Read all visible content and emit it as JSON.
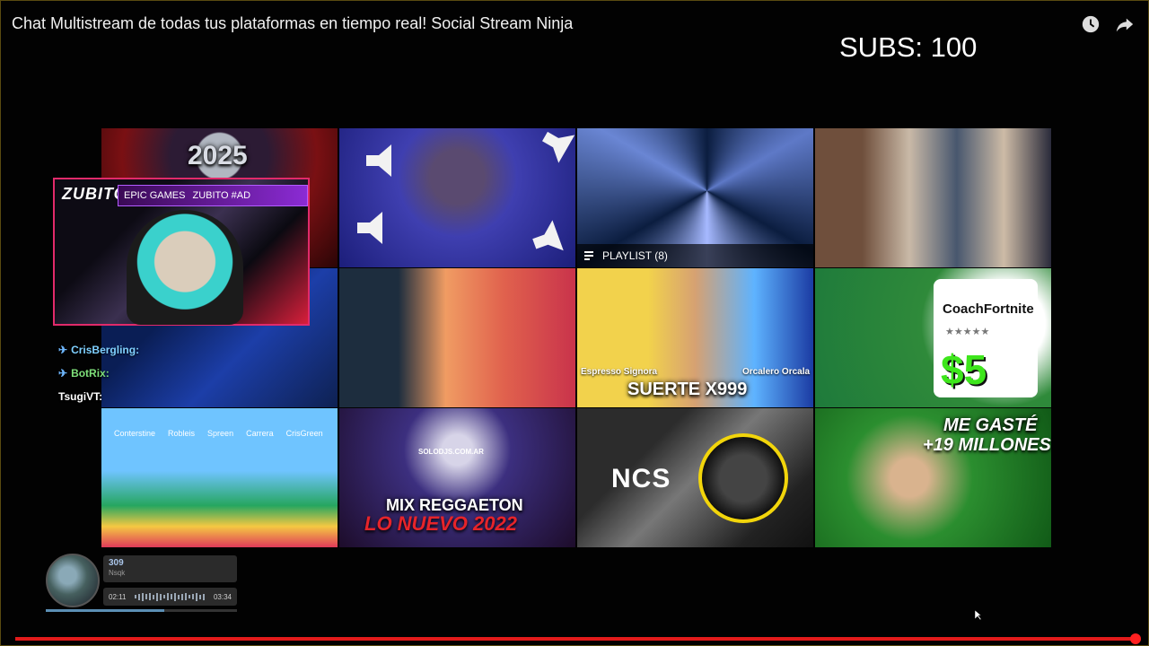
{
  "video": {
    "title": "Chat Multistream de todas tus plataformas en tiempo real! Social Stream Ninja"
  },
  "top_icons": [
    "watch-later-icon",
    "share-icon"
  ],
  "overlay_counter": {
    "text": "SUBS: 100"
  },
  "endscreen": {
    "tiles": [
      {
        "name": "tile-2025",
        "caption": "2025"
      },
      {
        "name": "tile-loud-sounds",
        "caption": ""
      },
      {
        "name": "tile-playlist",
        "caption": "",
        "playlist_label": "PLAYLIST (8)"
      },
      {
        "name": "tile-suits",
        "caption": ""
      },
      {
        "name": "tile-boxing",
        "caption": ""
      },
      {
        "name": "tile-suerte",
        "caption": "SUERTE X999",
        "labels": [
          "Espresso Signora",
          "Orcalero Orcala"
        ]
      },
      {
        "name": "tile-coach-fortnite",
        "caption": "CoachFortnite",
        "price": "$5"
      },
      {
        "name": "tile-minecraft-squid",
        "caption": "",
        "labels": [
          "Conterstine",
          "Robleis",
          "Spreen",
          "Carrera",
          "CrisGreen"
        ]
      },
      {
        "name": "tile-mix-reggaeton",
        "caption": "MIX REGGAETON",
        "caption2": "LO NUEVO 2022",
        "site": "SOLODJS.COM.AR"
      },
      {
        "name": "tile-ncs",
        "caption": "NCS"
      },
      {
        "name": "tile-me-gaste",
        "caption": "ME GASTÉ",
        "caption2": "+19 MILLONES"
      }
    ]
  },
  "stream_overlay": {
    "logo": "ZUBITO",
    "banner_brand": "EPIC GAMES",
    "banner_code": "ZUBITO #AD"
  },
  "chat": [
    {
      "name": "CrisBergling:",
      "color": "#7fd0ff"
    },
    {
      "name": "BotRix:",
      "color": "#7fe07a"
    },
    {
      "name": "TsugiVT:",
      "color": "#ffffff"
    }
  ],
  "music_player": {
    "track": "309",
    "artist": "Nsqk",
    "elapsed": "02:11",
    "duration": "03:34",
    "progress": 0.62
  },
  "progress": {
    "played": 0.995
  },
  "colors": {
    "accent": "#e11a1a",
    "overlay_border": "#e12a6a"
  }
}
